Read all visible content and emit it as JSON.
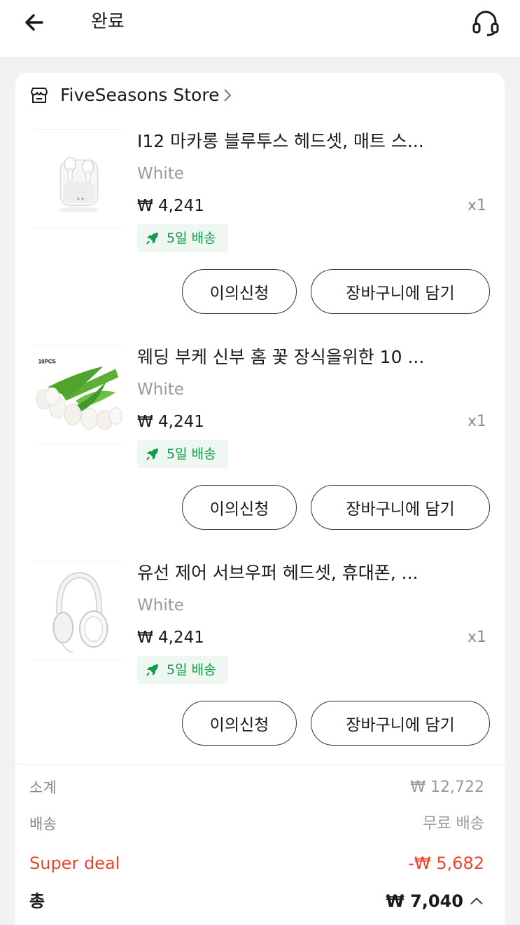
{
  "header": {
    "title": "완료",
    "back_icon": "arrow-left-icon",
    "support_icon": "headset-icon"
  },
  "store": {
    "name": "FiveSeasons Store",
    "icon": "store-icon",
    "chevron_icon": "chevron-right-icon"
  },
  "items": [
    {
      "title": "I12 마카롱 블루투스 헤드셋, 매트 스...",
      "variant": "White",
      "price": "₩ 4,241",
      "qty": "x1",
      "shipping": "5일 배송",
      "dispute_label": "이의신청",
      "cart_label": "장바구니에 담기"
    },
    {
      "title": "웨딩 부케 신부 홈 꽃 장식을위한 10 ...",
      "variant": "White",
      "price": "₩ 4,241",
      "qty": "x1",
      "shipping": "5일 배송",
      "dispute_label": "이의신청",
      "cart_label": "장바구니에 담기",
      "thumb_badge": "10PCS"
    },
    {
      "title": "유선 제어 서브우퍼 헤드셋, 휴대폰, ...",
      "variant": "White",
      "price": "₩ 4,241",
      "qty": "x1",
      "shipping": "5일 배송",
      "dispute_label": "이의신청",
      "cart_label": "장바구니에 담기"
    }
  ],
  "summary": {
    "subtotal_label": "소계",
    "subtotal_value": "₩ 12,722",
    "shipping_label": "배송",
    "shipping_value": "무료 배송",
    "deal_label": "Super deal",
    "deal_value": "-₩ 5,682",
    "total_label": "총",
    "total_value": "₩ 7,040"
  },
  "colors": {
    "accent_red": "#e8462e",
    "shipping_green": "#169b4c",
    "shipping_bg": "#eef7f1"
  }
}
